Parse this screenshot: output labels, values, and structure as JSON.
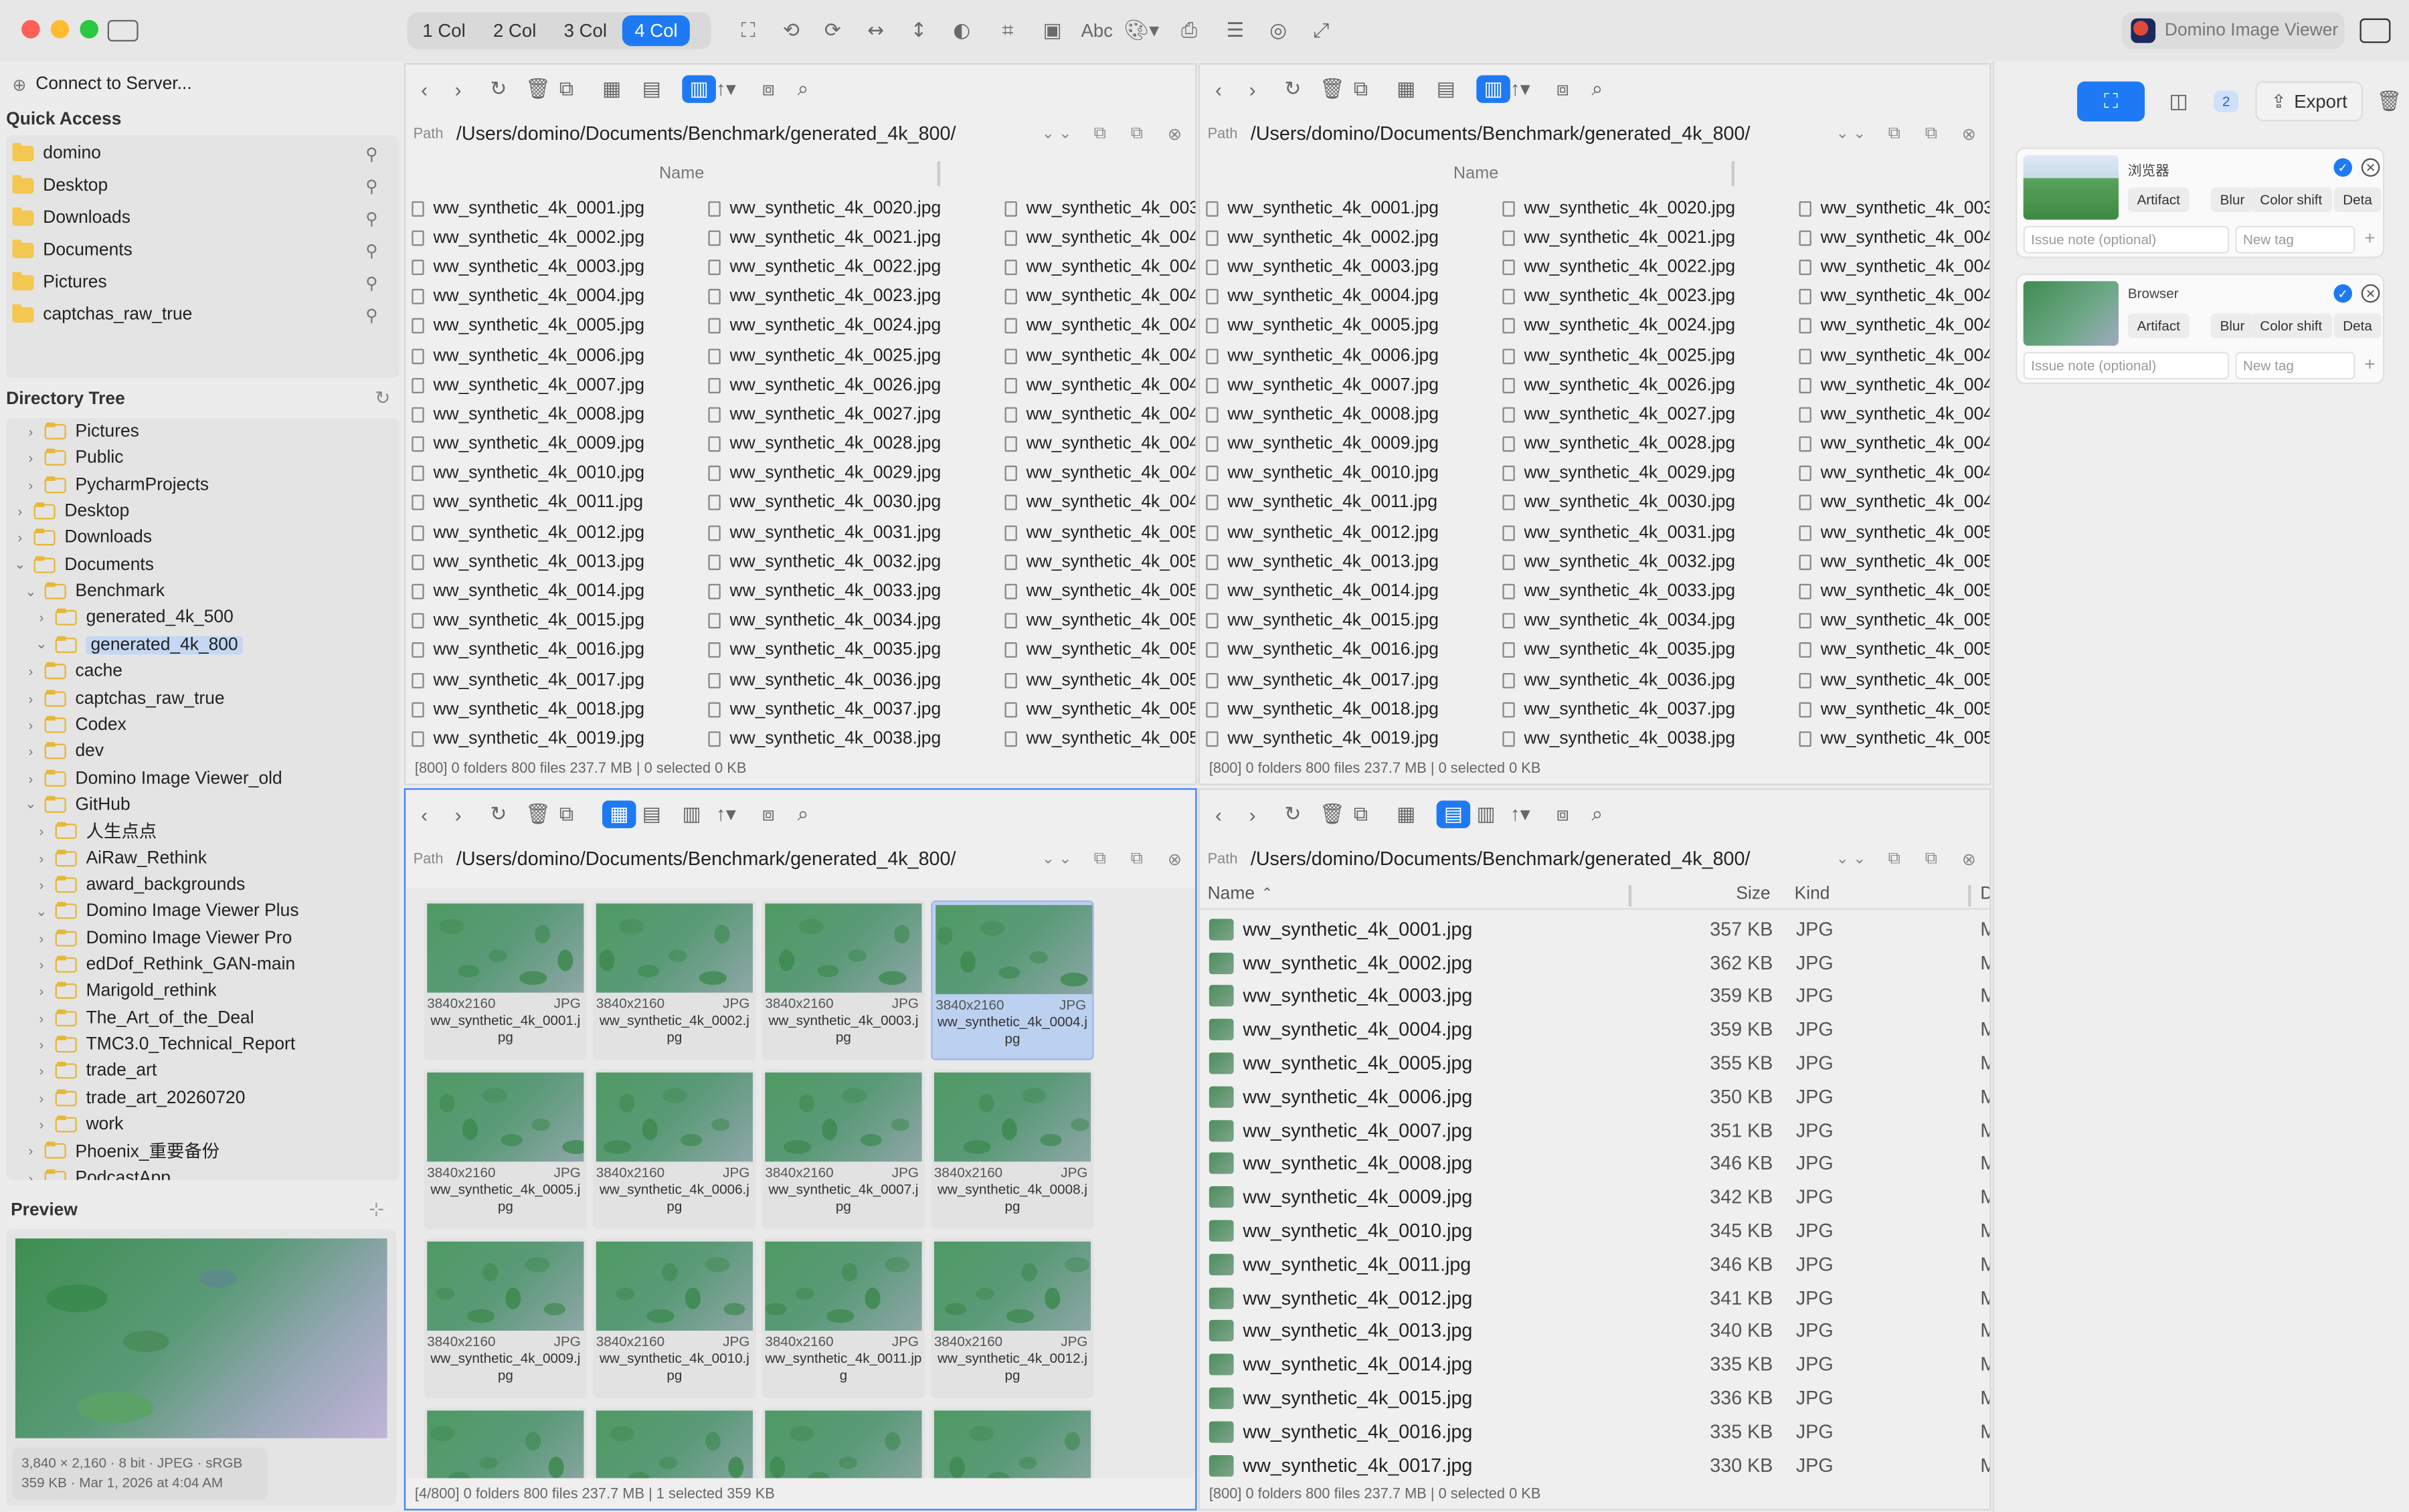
{
  "toolbar": {
    "columns": [
      "1 Col",
      "2 Col",
      "3 Col",
      "4 Col"
    ],
    "active_column": "4 Col",
    "text_tool": "Abc",
    "viewer_label": "Domino Image Viewer"
  },
  "sidebar": {
    "connect": "Connect to Server...",
    "quick_access_title": "Quick Access",
    "quick_access": [
      "domino",
      "Desktop",
      "Downloads",
      "Documents",
      "Pictures",
      "captchas_raw_true"
    ],
    "tree_title": "Directory Tree",
    "tree": [
      {
        "label": "Pictures",
        "depth": 1,
        "state": "closed"
      },
      {
        "label": "Public",
        "depth": 1,
        "state": "closed"
      },
      {
        "label": "PycharmProjects",
        "depth": 1,
        "state": "closed"
      },
      {
        "label": "Desktop",
        "depth": 0,
        "state": "closed"
      },
      {
        "label": "Downloads",
        "depth": 0,
        "state": "closed"
      },
      {
        "label": "Documents",
        "depth": 0,
        "state": "open"
      },
      {
        "label": "Benchmark",
        "depth": 1,
        "state": "open"
      },
      {
        "label": "generated_4k_500",
        "depth": 2,
        "state": "closed"
      },
      {
        "label": "generated_4k_800",
        "depth": 2,
        "state": "open",
        "selected": true
      },
      {
        "label": "cache",
        "depth": 1,
        "state": "closed"
      },
      {
        "label": "captchas_raw_true",
        "depth": 1,
        "state": "closed"
      },
      {
        "label": "Codex",
        "depth": 1,
        "state": "closed"
      },
      {
        "label": "dev",
        "depth": 1,
        "state": "closed"
      },
      {
        "label": "Domino Image Viewer_old",
        "depth": 1,
        "state": "closed"
      },
      {
        "label": "GitHub",
        "depth": 1,
        "state": "open"
      },
      {
        "label": "人生点点",
        "depth": 2,
        "state": "closed"
      },
      {
        "label": "AiRaw_Rethink",
        "depth": 2,
        "state": "closed"
      },
      {
        "label": "award_backgrounds",
        "depth": 2,
        "state": "closed"
      },
      {
        "label": "Domino Image Viewer Plus",
        "depth": 2,
        "state": "open"
      },
      {
        "label": "Domino Image Viewer Pro",
        "depth": 2,
        "state": "closed"
      },
      {
        "label": "edDof_Rethink_GAN-main",
        "depth": 2,
        "state": "closed"
      },
      {
        "label": "Marigold_rethink",
        "depth": 2,
        "state": "closed"
      },
      {
        "label": "The_Art_of_the_Deal",
        "depth": 2,
        "state": "closed"
      },
      {
        "label": "TMC3.0_Technical_Report",
        "depth": 2,
        "state": "closed"
      },
      {
        "label": "trade_art",
        "depth": 2,
        "state": "closed"
      },
      {
        "label": "trade_art_20260720",
        "depth": 2,
        "state": "closed"
      },
      {
        "label": "work",
        "depth": 2,
        "state": "closed"
      },
      {
        "label": "Phoenix_重要备份",
        "depth": 1,
        "state": "closed"
      },
      {
        "label": "PodcastApp",
        "depth": 1,
        "state": "closed"
      }
    ],
    "preview_title": "Preview",
    "preview_info1": "3,840 × 2,160 · 8 bit · JPEG · sRGB",
    "preview_info2": "359 KB · Mar 1, 2026 at 4:04 AM"
  },
  "panes": {
    "path_label": "Path",
    "path": "/Users/domino/Documents/Benchmark/generated_4k_800/",
    "name_header": "Name",
    "col1": [
      "ww_synthetic_4k_0001.jpg",
      "ww_synthetic_4k_0002.jpg",
      "ww_synthetic_4k_0003.jpg",
      "ww_synthetic_4k_0004.jpg",
      "ww_synthetic_4k_0005.jpg",
      "ww_synthetic_4k_0006.jpg",
      "ww_synthetic_4k_0007.jpg",
      "ww_synthetic_4k_0008.jpg",
      "ww_synthetic_4k_0009.jpg",
      "ww_synthetic_4k_0010.jpg",
      "ww_synthetic_4k_0011.jpg",
      "ww_synthetic_4k_0012.jpg",
      "ww_synthetic_4k_0013.jpg",
      "ww_synthetic_4k_0014.jpg",
      "ww_synthetic_4k_0015.jpg",
      "ww_synthetic_4k_0016.jpg",
      "ww_synthetic_4k_0017.jpg",
      "ww_synthetic_4k_0018.jpg",
      "ww_synthetic_4k_0019.jpg"
    ],
    "col2": [
      "ww_synthetic_4k_0020.jpg",
      "ww_synthetic_4k_0021.jpg",
      "ww_synthetic_4k_0022.jpg",
      "ww_synthetic_4k_0023.jpg",
      "ww_synthetic_4k_0024.jpg",
      "ww_synthetic_4k_0025.jpg",
      "ww_synthetic_4k_0026.jpg",
      "ww_synthetic_4k_0027.jpg",
      "ww_synthetic_4k_0028.jpg",
      "ww_synthetic_4k_0029.jpg",
      "ww_synthetic_4k_0030.jpg",
      "ww_synthetic_4k_0031.jpg",
      "ww_synthetic_4k_0032.jpg",
      "ww_synthetic_4k_0033.jpg",
      "ww_synthetic_4k_0034.jpg",
      "ww_synthetic_4k_0035.jpg",
      "ww_synthetic_4k_0036.jpg",
      "ww_synthetic_4k_0037.jpg",
      "ww_synthetic_4k_0038.jpg"
    ],
    "col3": [
      "ww_synthetic_4k_003",
      "ww_synthetic_4k_004",
      "ww_synthetic_4k_004",
      "ww_synthetic_4k_004",
      "ww_synthetic_4k_004",
      "ww_synthetic_4k_004",
      "ww_synthetic_4k_004",
      "ww_synthetic_4k_004",
      "ww_synthetic_4k_004",
      "ww_synthetic_4k_004",
      "ww_synthetic_4k_004",
      "ww_synthetic_4k_005",
      "ww_synthetic_4k_005",
      "ww_synthetic_4k_005",
      "ww_synthetic_4k_005",
      "ww_synthetic_4k_005",
      "ww_synthetic_4k_005",
      "ww_synthetic_4k_005",
      "ww_synthetic_4k_005"
    ],
    "status_full": "[800]   0 folders   800 files   237.7 MB   |   0 selected   0 KB",
    "status_grid": "[4/800]   0 folders   800 files   237.7 MB   |   1 selected   359 KB",
    "thumbs": [
      {
        "dim": "3840x2160",
        "fmt": "JPG",
        "name": "ww_synthetic_4k_0001.jpg"
      },
      {
        "dim": "3840x2160",
        "fmt": "JPG",
        "name": "ww_synthetic_4k_0002.jpg"
      },
      {
        "dim": "3840x2160",
        "fmt": "JPG",
        "name": "ww_synthetic_4k_0003.jpg"
      },
      {
        "dim": "3840x2160",
        "fmt": "JPG",
        "name": "ww_synthetic_4k_0004.jpg"
      },
      {
        "dim": "3840x2160",
        "fmt": "JPG",
        "name": "ww_synthetic_4k_0005.jpg"
      },
      {
        "dim": "3840x2160",
        "fmt": "JPG",
        "name": "ww_synthetic_4k_0006.jpg"
      },
      {
        "dim": "3840x2160",
        "fmt": "JPG",
        "name": "ww_synthetic_4k_0007.jpg"
      },
      {
        "dim": "3840x2160",
        "fmt": "JPG",
        "name": "ww_synthetic_4k_0008.jpg"
      },
      {
        "dim": "3840x2160",
        "fmt": "JPG",
        "name": "ww_synthetic_4k_0009.jpg"
      },
      {
        "dim": "3840x2160",
        "fmt": "JPG",
        "name": "ww_synthetic_4k_0010.jpg"
      },
      {
        "dim": "3840x2160",
        "fmt": "JPG",
        "name": "ww_synthetic_4k_0011.jpg"
      },
      {
        "dim": "3840x2160",
        "fmt": "JPG",
        "name": "ww_synthetic_4k_0012.jpg"
      }
    ],
    "list_headers": {
      "name": "Name",
      "size": "Size",
      "kind": "Kind",
      "more": "D"
    },
    "list_rows": [
      {
        "name": "ww_synthetic_4k_0001.jpg",
        "size": "357 KB",
        "kind": "JPG"
      },
      {
        "name": "ww_synthetic_4k_0002.jpg",
        "size": "362 KB",
        "kind": "JPG"
      },
      {
        "name": "ww_synthetic_4k_0003.jpg",
        "size": "359 KB",
        "kind": "JPG"
      },
      {
        "name": "ww_synthetic_4k_0004.jpg",
        "size": "359 KB",
        "kind": "JPG"
      },
      {
        "name": "ww_synthetic_4k_0005.jpg",
        "size": "355 KB",
        "kind": "JPG"
      },
      {
        "name": "ww_synthetic_4k_0006.jpg",
        "size": "350 KB",
        "kind": "JPG"
      },
      {
        "name": "ww_synthetic_4k_0007.jpg",
        "size": "351 KB",
        "kind": "JPG"
      },
      {
        "name": "ww_synthetic_4k_0008.jpg",
        "size": "346 KB",
        "kind": "JPG"
      },
      {
        "name": "ww_synthetic_4k_0009.jpg",
        "size": "342 KB",
        "kind": "JPG"
      },
      {
        "name": "ww_synthetic_4k_0010.jpg",
        "size": "345 KB",
        "kind": "JPG"
      },
      {
        "name": "ww_synthetic_4k_0011.jpg",
        "size": "346 KB",
        "kind": "JPG"
      },
      {
        "name": "ww_synthetic_4k_0012.jpg",
        "size": "341 KB",
        "kind": "JPG"
      },
      {
        "name": "ww_synthetic_4k_0013.jpg",
        "size": "340 KB",
        "kind": "JPG"
      },
      {
        "name": "ww_synthetic_4k_0014.jpg",
        "size": "335 KB",
        "kind": "JPG"
      },
      {
        "name": "ww_synthetic_4k_0015.jpg",
        "size": "336 KB",
        "kind": "JPG"
      },
      {
        "name": "ww_synthetic_4k_0016.jpg",
        "size": "335 KB",
        "kind": "JPG"
      },
      {
        "name": "ww_synthetic_4k_0017.jpg",
        "size": "330 KB",
        "kind": "JPG"
      }
    ],
    "list_more_col": "M"
  },
  "rpanel": {
    "badge": "2",
    "export_label": "Export",
    "cards": [
      {
        "title": "浏览器",
        "tags": [
          "Artifact",
          "Blur",
          "Color shift",
          "Deta"
        ],
        "note_placeholder": "Issue note (optional)",
        "tag_placeholder": "New tag"
      },
      {
        "title": "Browser",
        "tags": [
          "Artifact",
          "Blur",
          "Color shift",
          "Deta"
        ],
        "note_placeholder": "Issue note (optional)",
        "tag_placeholder": "New tag"
      }
    ]
  },
  "colors": {
    "accent": "#1e7af4",
    "folder": "#f4c750",
    "selection": "#bcd0ef"
  }
}
